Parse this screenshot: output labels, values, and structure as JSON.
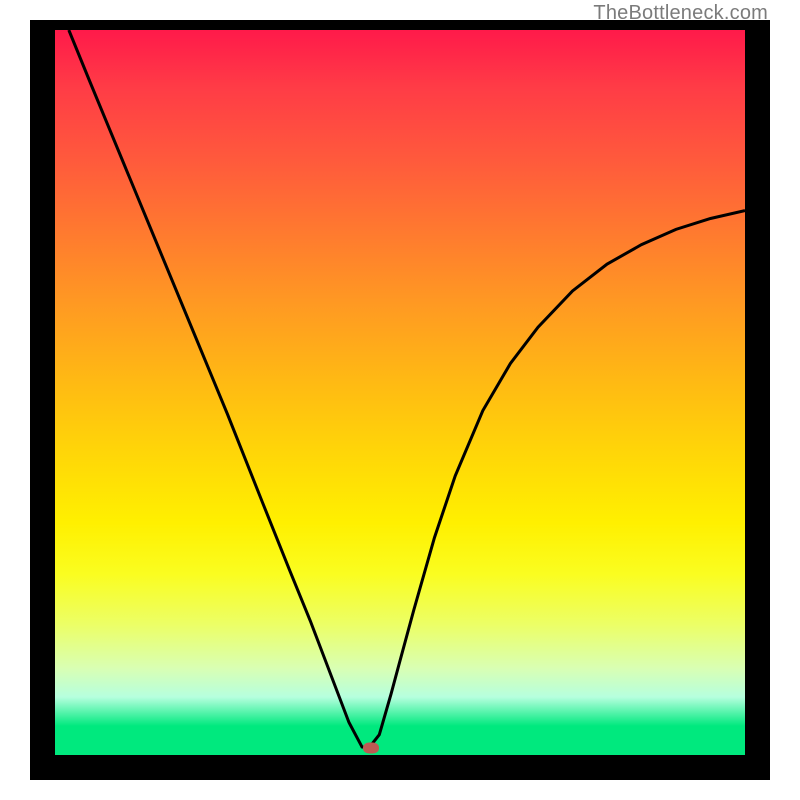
{
  "watermark": {
    "text": "TheBottleneck.com"
  },
  "chart_data": {
    "type": "line",
    "title": "",
    "xlabel": "",
    "ylabel": "",
    "xlim": [
      0,
      100
    ],
    "ylim": [
      0,
      100
    ],
    "grid": false,
    "legend": false,
    "series": [
      {
        "name": "curve",
        "x": [
          2,
          5,
          10,
          15,
          20,
          25,
          30,
          34,
          37,
          39,
          41,
          42.6,
          44.5,
          45.5,
          47,
          48.7,
          50,
          52,
          55,
          58,
          62,
          66,
          70,
          75,
          80,
          85,
          90,
          95,
          100
        ],
        "y": [
          100,
          93,
          81.5,
          70,
          58.5,
          47,
          35,
          25.5,
          18.5,
          13.5,
          8.5,
          4.5,
          1.1,
          1.0,
          2.8,
          8.4,
          13,
          20,
          30,
          38.5,
          47.5,
          54,
          59,
          64,
          67.7,
          70.4,
          72.5,
          74,
          75.1
        ]
      }
    ],
    "marker": {
      "x": 45.8,
      "y": 0.9
    },
    "background_gradient": {
      "stops": [
        {
          "pos": 0,
          "color": "#ff1a4a"
        },
        {
          "pos": 50,
          "color": "#ffd508"
        },
        {
          "pos": 75,
          "color": "#fafd20"
        },
        {
          "pos": 96,
          "color": "#00e97e"
        },
        {
          "pos": 100,
          "color": "#00e97e"
        }
      ]
    }
  }
}
